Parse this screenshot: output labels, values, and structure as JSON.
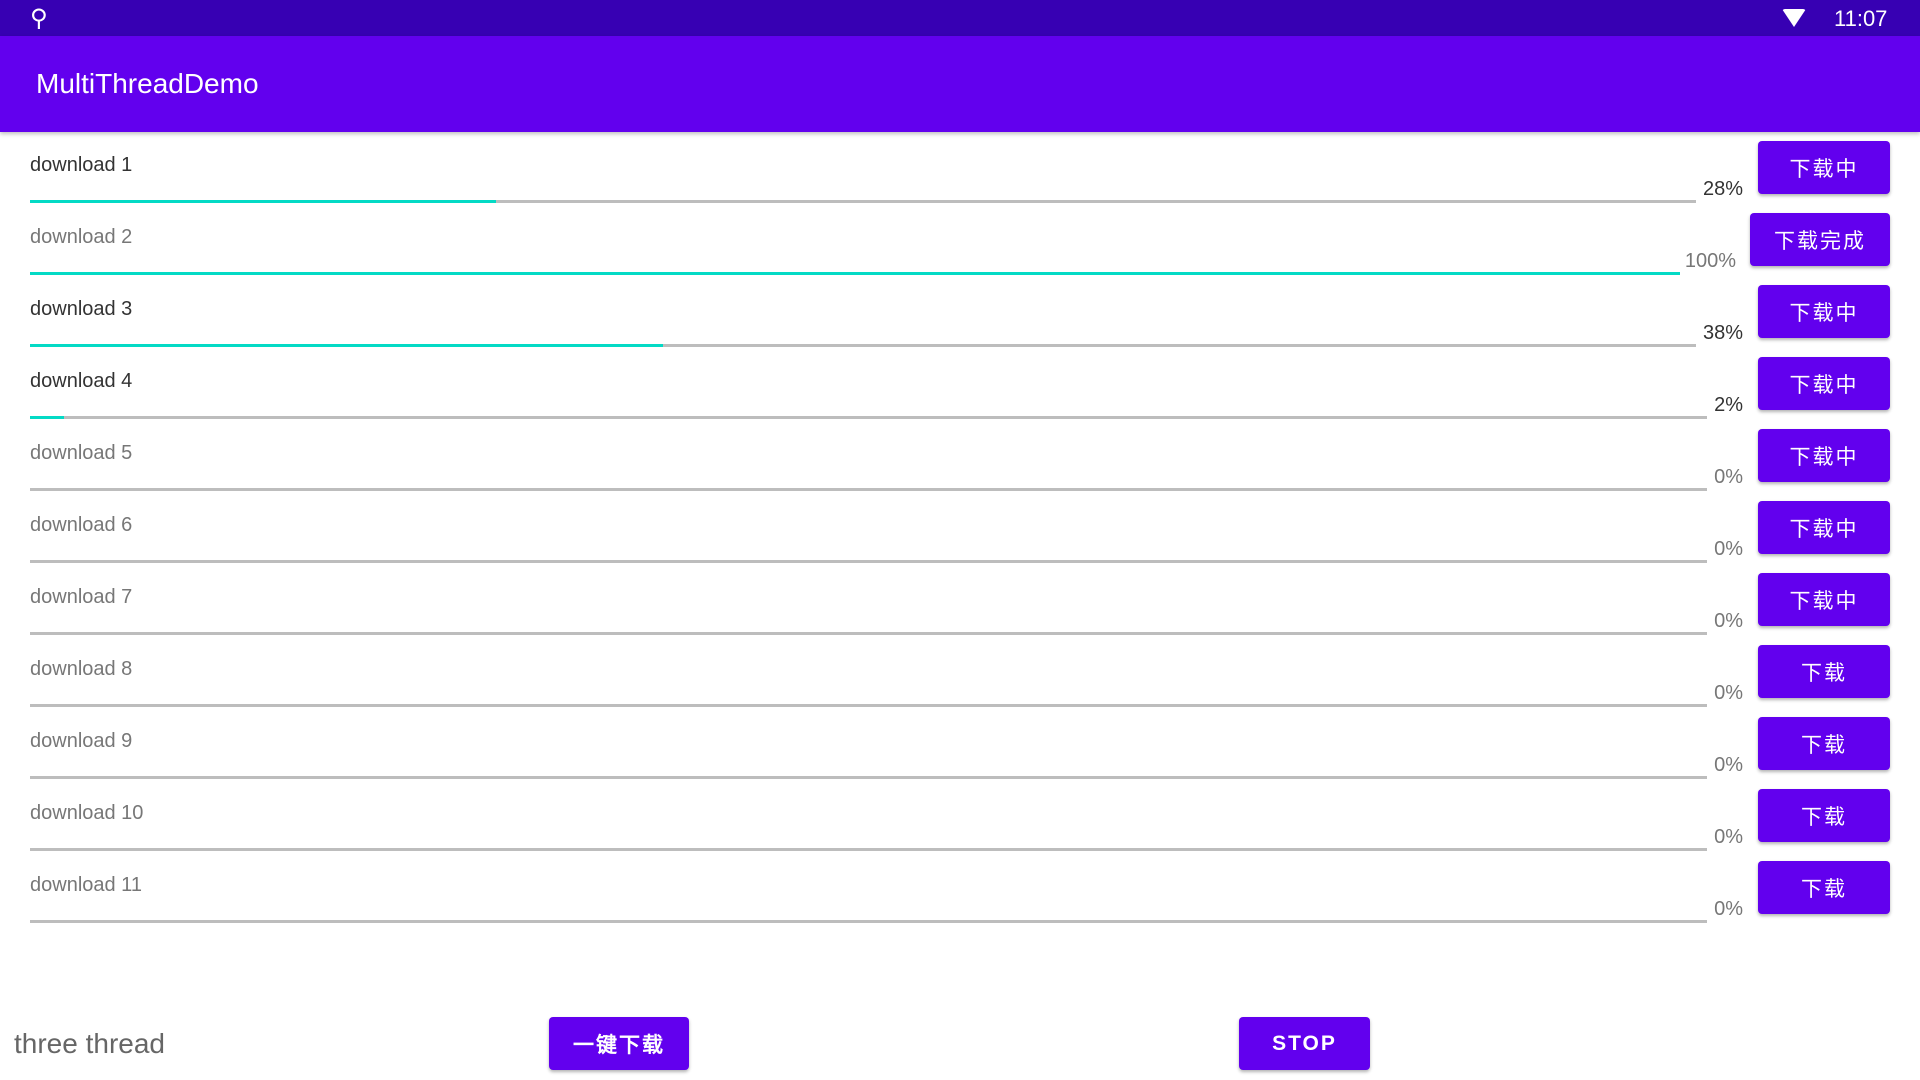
{
  "status_bar": {
    "time": "11:07",
    "usb_icon": "usb-icon",
    "wifi_icon": "wifi-icon"
  },
  "app": {
    "title": "MultiThreadDemo"
  },
  "downloads": [
    {
      "label": "download 1",
      "progress": 28,
      "percent": "28%",
      "button": "下载中",
      "active": true
    },
    {
      "label": "download 2",
      "progress": 100,
      "percent": "100%",
      "button": "下载完成",
      "active": false
    },
    {
      "label": "download 3",
      "progress": 38,
      "percent": "38%",
      "button": "下载中",
      "active": true
    },
    {
      "label": "download 4",
      "progress": 2,
      "percent": "2%",
      "button": "下载中",
      "active": true
    },
    {
      "label": "download 5",
      "progress": 0,
      "percent": "0%",
      "button": "下载中",
      "active": false
    },
    {
      "label": "download 6",
      "progress": 0,
      "percent": "0%",
      "button": "下载中",
      "active": false
    },
    {
      "label": "download 7",
      "progress": 0,
      "percent": "0%",
      "button": "下载中",
      "active": false
    },
    {
      "label": "download 8",
      "progress": 0,
      "percent": "0%",
      "button": "下载",
      "active": false
    },
    {
      "label": "download 9",
      "progress": 0,
      "percent": "0%",
      "button": "下载",
      "active": false
    },
    {
      "label": "download 10",
      "progress": 0,
      "percent": "0%",
      "button": "下载",
      "active": false
    },
    {
      "label": "download 11",
      "progress": 0,
      "percent": "0%",
      "button": "下载",
      "active": false
    }
  ],
  "footer": {
    "mode_label": "three thread",
    "download_all": "一键下载",
    "stop": "STOP"
  },
  "colors": {
    "primary": "#6200ee",
    "primary_dark": "#3700b3",
    "accent": "#03dac5"
  }
}
